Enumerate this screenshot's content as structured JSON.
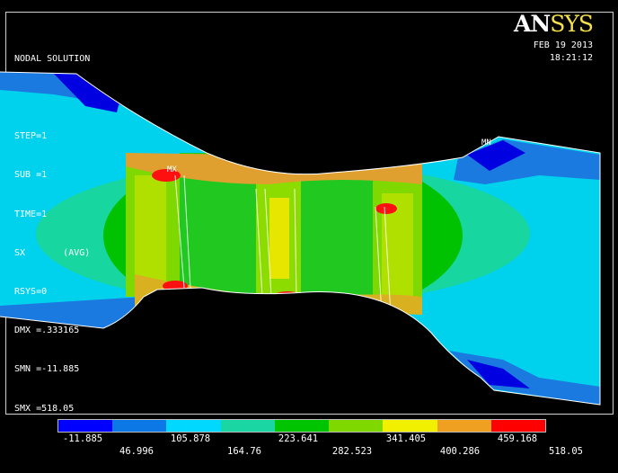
{
  "plot_info": {
    "lines": [
      "NODAL SOLUTION",
      "",
      "STEP=1",
      "SUB =1",
      "TIME=1",
      "SX       (AVG)",
      "RSYS=0",
      "DMX =.333165",
      "SMN =-11.885",
      "SMX =518.05"
    ]
  },
  "logo": {
    "an": "AN",
    "sys": "SYS"
  },
  "timestamp": {
    "date": "FEB 19 2013",
    "time": "18:21:12"
  },
  "markers": {
    "max": "MX",
    "min": "MN"
  },
  "legend": {
    "colors": [
      "#0000ff",
      "#0b78e6",
      "#00d8ff",
      "#1ad6a2",
      "#00c400",
      "#7fd800",
      "#f0f000",
      "#f0a020",
      "#ff0000"
    ],
    "row1": [
      "-11.885",
      "105.878",
      "223.641",
      "341.405",
      "459.168"
    ],
    "row2": [
      "46.996",
      "164.76",
      "282.523",
      "400.286",
      "518.05"
    ]
  }
}
